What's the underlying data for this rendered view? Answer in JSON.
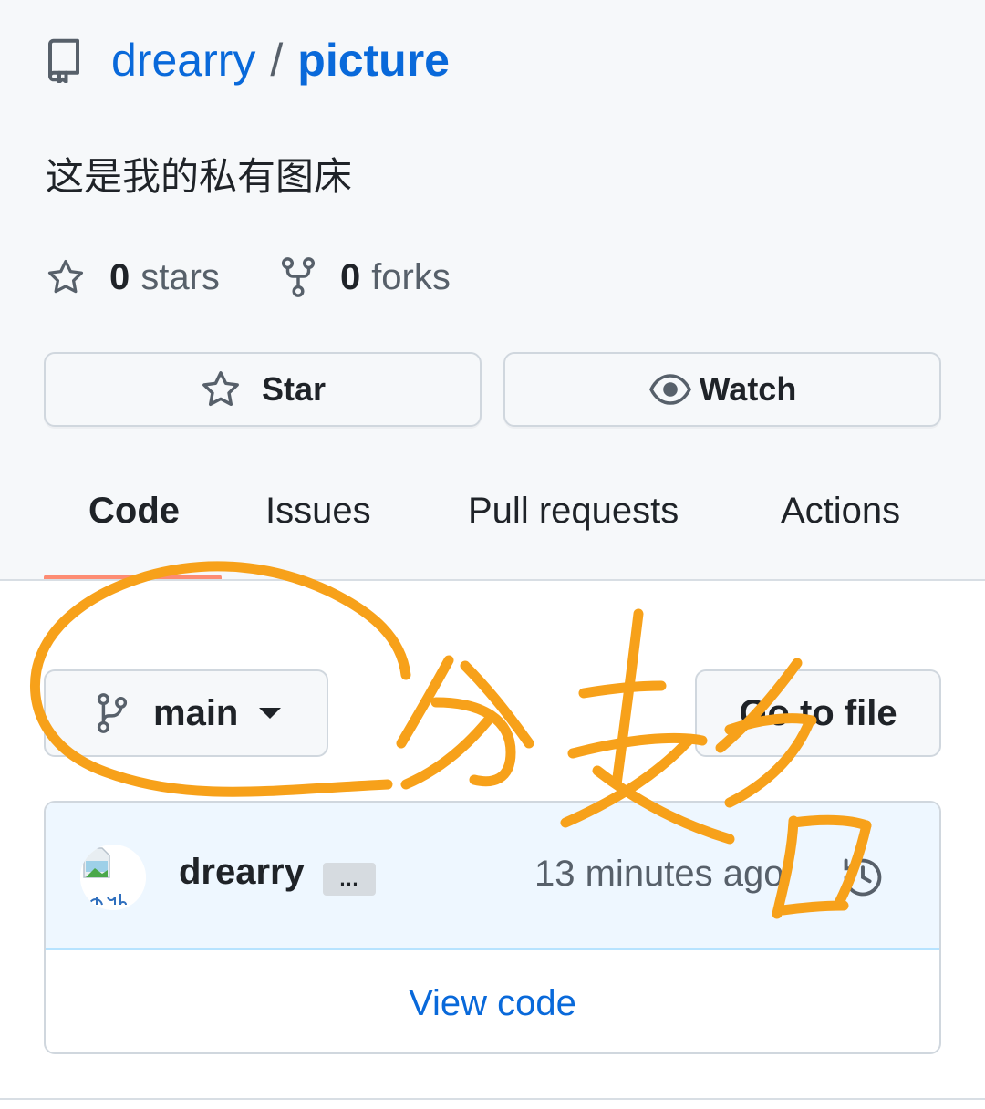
{
  "repo": {
    "owner": "drearry",
    "separator": "/",
    "name": "picture",
    "description": "这是我的私有图床"
  },
  "counts": {
    "stars_num": "0",
    "stars_label": "stars",
    "forks_num": "0",
    "forks_label": "forks"
  },
  "actions": {
    "star_label": "Star",
    "watch_label": "Watch"
  },
  "tabs": [
    {
      "label": "Code",
      "active": true
    },
    {
      "label": "Issues",
      "active": false
    },
    {
      "label": "Pull requests",
      "active": false
    },
    {
      "label": "Actions",
      "active": false
    }
  ],
  "branch": {
    "current": "main"
  },
  "goto_file_label": "Go to file",
  "commit": {
    "author": "drearry",
    "ellipsis": "…",
    "time": "13 minutes ago"
  },
  "view_code_label": "View code",
  "colors": {
    "link": "#0969da",
    "tab_underline": "#fd8c73",
    "annotation": "#f7a11a"
  }
}
